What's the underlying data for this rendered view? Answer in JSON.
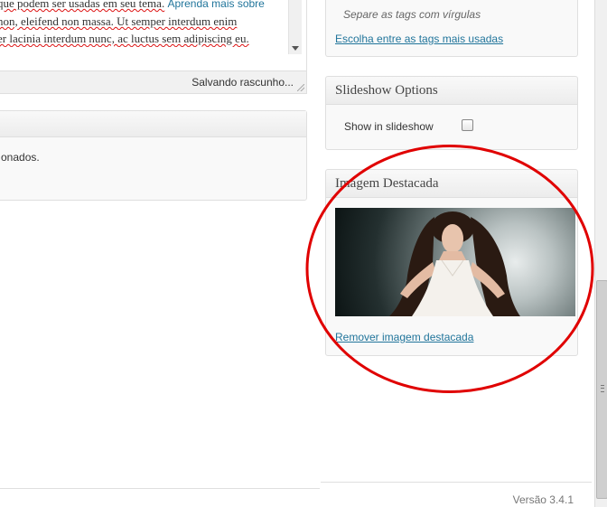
{
  "editor": {
    "lines": [
      {
        "parts": [
          {
            "text": "que podem ser usadas em seu tema.",
            "squig": true
          },
          {
            "text": " "
          },
          {
            "text": "Aprenda mais sobre",
            "link": true
          }
        ]
      },
      {
        "parts": [
          {
            "text": "non, eleifend non massa. Ut semper interdum enim",
            "squig": true
          }
        ]
      },
      {
        "parts": [
          {
            "text": "er lacinia interdum nunc, ac luctus sem adipiscing eu.",
            "squig": true
          }
        ]
      }
    ],
    "save_status": "Salvando rascunho..."
  },
  "left_box": {
    "text": "onados."
  },
  "tags": {
    "hint": "Separe as tags com vírgulas",
    "most_used_link": "Escolha entre as tags mais usadas"
  },
  "slideshow": {
    "title": "Slideshow Options",
    "show_label": "Show in slideshow",
    "checked": false
  },
  "featured_image": {
    "title": "Imagem Destacada",
    "remove_link": "Remover imagem destacada",
    "image_desc": "woman-in-white-dress-photo"
  },
  "footer": {
    "version": "Versão 3.4.1"
  },
  "colors": {
    "link": "#21759b",
    "annotation": "#e00000"
  }
}
